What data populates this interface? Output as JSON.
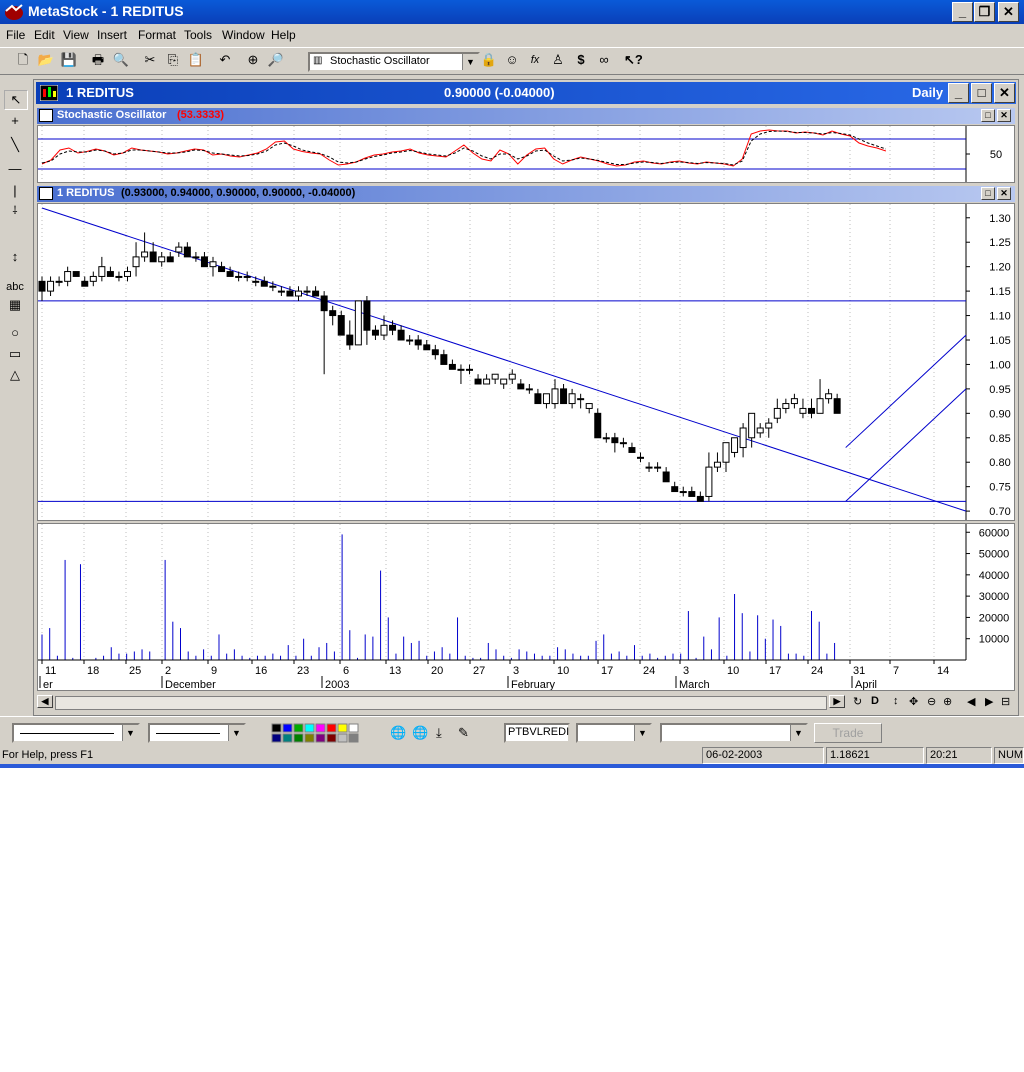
{
  "window": {
    "app_title": "MetaStock - 1 REDITUS"
  },
  "menu": [
    "File",
    "Edit",
    "View",
    "Insert",
    "Format",
    "Tools",
    "Window",
    "Help"
  ],
  "toolbar": {
    "indicator_select": "Stochastic Oscillator"
  },
  "chart_window": {
    "title": "1 REDITUS",
    "price_readout": "0.90000 (-0.04000)",
    "period": "Daily"
  },
  "stoch_pane": {
    "label": "Stochastic Oscillator",
    "value": "(53.3333)",
    "level_label": "50"
  },
  "price_pane": {
    "label": "1 REDITUS",
    "ohlc": "(0.93000, 0.94000, 0.90000, 0.90000, -0.04000)"
  },
  "colors": {
    "accent_red": "#ff0000",
    "line_blue": "#0000cc",
    "title_blue": "#0a3fb8"
  },
  "chart_data": [
    {
      "type": "line",
      "title": "Stochastic Oscillator",
      "series": [
        {
          "name": "Stochastic Oscillator",
          "color": "#ff0000",
          "values": [
            30,
            38,
            58,
            62,
            52,
            55,
            60,
            56,
            48,
            52,
            62,
            58,
            56,
            54,
            50,
            52,
            56,
            60,
            58,
            48,
            50,
            46,
            44,
            48,
            52,
            60,
            74,
            76,
            60,
            55,
            52,
            50,
            38,
            28,
            30,
            34,
            42,
            48,
            50,
            54,
            56,
            60,
            52,
            48,
            46,
            44,
            56,
            68,
            52,
            40,
            36,
            58,
            50,
            30,
            48,
            60,
            62,
            40,
            30,
            38,
            44,
            40,
            36,
            30,
            26,
            28,
            34,
            36,
            32,
            30,
            34,
            36,
            32,
            30,
            34,
            32,
            30,
            26,
            40,
            90,
            96,
            98,
            96,
            96,
            92,
            94,
            92,
            88,
            96,
            90,
            86,
            72,
            66,
            62,
            56
          ]
        },
        {
          "name": "",
          "style": "dashed",
          "color": "#000000",
          "values": [
            32,
            36,
            50,
            56,
            54,
            54,
            58,
            56,
            50,
            52,
            58,
            58,
            56,
            54,
            52,
            52,
            54,
            58,
            57,
            52,
            50,
            48,
            46,
            47,
            50,
            56,
            68,
            72,
            66,
            58,
            54,
            51,
            44,
            34,
            32,
            34,
            40,
            45,
            48,
            52,
            54,
            57,
            54,
            50,
            48,
            46,
            52,
            62,
            56,
            46,
            40,
            50,
            50,
            40,
            46,
            56,
            58,
            46,
            36,
            38,
            42,
            40,
            37,
            33,
            29,
            29,
            32,
            34,
            33,
            31,
            33,
            34,
            33,
            31,
            33,
            32,
            31,
            28,
            36,
            76,
            90,
            95,
            96,
            95,
            93,
            93,
            92,
            90,
            93,
            91,
            88,
            80,
            72,
            66,
            60
          ]
        }
      ],
      "level_lines": [
        80,
        20
      ],
      "ytick_labels": [
        "50"
      ]
    },
    {
      "type": "candlestick",
      "title": "1 REDITUS",
      "ylim": [
        0.69,
        1.32
      ],
      "yticks": [
        1.3,
        1.25,
        1.2,
        1.15,
        1.1,
        1.05,
        1.0,
        0.95,
        0.9,
        0.85,
        0.8,
        0.75,
        0.7
      ],
      "hlines": [
        1.13,
        0.72
      ],
      "trendlines": [
        {
          "from": [
            0,
            1.32
          ],
          "to": [
            120,
            0.7
          ]
        },
        {
          "from": [
            94,
            0.83
          ],
          "to": [
            112,
            1.06
          ]
        },
        {
          "from": [
            94,
            0.72
          ],
          "to": [
            112,
            0.95
          ]
        }
      ],
      "candles": [
        [
          1.17,
          1.18,
          1.13,
          1.15
        ],
        [
          1.15,
          1.18,
          1.14,
          1.17
        ],
        [
          1.17,
          1.18,
          1.16,
          1.17
        ],
        [
          1.17,
          1.2,
          1.16,
          1.19
        ],
        [
          1.19,
          1.19,
          1.18,
          1.18
        ],
        [
          1.17,
          1.18,
          1.16,
          1.16
        ],
        [
          1.17,
          1.19,
          1.16,
          1.18
        ],
        [
          1.18,
          1.22,
          1.17,
          1.2
        ],
        [
          1.19,
          1.2,
          1.18,
          1.18
        ],
        [
          1.18,
          1.19,
          1.17,
          1.18
        ],
        [
          1.18,
          1.2,
          1.17,
          1.19
        ],
        [
          1.2,
          1.25,
          1.18,
          1.22
        ],
        [
          1.22,
          1.27,
          1.21,
          1.23
        ],
        [
          1.23,
          1.25,
          1.21,
          1.21
        ],
        [
          1.21,
          1.23,
          1.2,
          1.22
        ],
        [
          1.22,
          1.23,
          1.21,
          1.21
        ],
        [
          1.23,
          1.25,
          1.22,
          1.24
        ],
        [
          1.24,
          1.25,
          1.22,
          1.22
        ],
        [
          1.22,
          1.23,
          1.21,
          1.22
        ],
        [
          1.22,
          1.23,
          1.2,
          1.2
        ],
        [
          1.2,
          1.22,
          1.18,
          1.21
        ],
        [
          1.2,
          1.21,
          1.19,
          1.19
        ],
        [
          1.19,
          1.2,
          1.18,
          1.18
        ],
        [
          1.18,
          1.19,
          1.17,
          1.18
        ],
        [
          1.18,
          1.19,
          1.17,
          1.18
        ],
        [
          1.17,
          1.18,
          1.16,
          1.17
        ],
        [
          1.17,
          1.18,
          1.16,
          1.16
        ],
        [
          1.16,
          1.17,
          1.15,
          1.16
        ],
        [
          1.15,
          1.16,
          1.14,
          1.15
        ],
        [
          1.15,
          1.16,
          1.14,
          1.14
        ],
        [
          1.14,
          1.16,
          1.13,
          1.15
        ],
        [
          1.15,
          1.16,
          1.14,
          1.15
        ],
        [
          1.15,
          1.16,
          1.14,
          1.14
        ],
        [
          1.14,
          1.15,
          0.98,
          1.11
        ],
        [
          1.11,
          1.12,
          1.08,
          1.1
        ],
        [
          1.1,
          1.11,
          1.07,
          1.06
        ],
        [
          1.06,
          1.09,
          1.03,
          1.04
        ],
        [
          1.04,
          1.13,
          1.04,
          1.13
        ],
        [
          1.13,
          1.14,
          1.04,
          1.07
        ],
        [
          1.07,
          1.08,
          1.05,
          1.06
        ],
        [
          1.06,
          1.1,
          1.05,
          1.08
        ],
        [
          1.08,
          1.09,
          1.06,
          1.07
        ],
        [
          1.07,
          1.08,
          1.05,
          1.05
        ],
        [
          1.05,
          1.06,
          1.04,
          1.05
        ],
        [
          1.05,
          1.06,
          1.03,
          1.04
        ],
        [
          1.04,
          1.05,
          1.03,
          1.03
        ],
        [
          1.03,
          1.04,
          1.01,
          1.02
        ],
        [
          1.02,
          1.03,
          1.0,
          1.0
        ],
        [
          1.0,
          1.01,
          0.99,
          0.99
        ],
        [
          0.99,
          1.0,
          0.96,
          0.99
        ],
        [
          0.99,
          1.0,
          0.98,
          0.99
        ],
        [
          0.97,
          0.98,
          0.96,
          0.96
        ],
        [
          0.96,
          0.98,
          0.96,
          0.97
        ],
        [
          0.97,
          0.98,
          0.96,
          0.98
        ],
        [
          0.96,
          0.97,
          0.95,
          0.97
        ],
        [
          0.97,
          0.99,
          0.96,
          0.98
        ],
        [
          0.96,
          0.97,
          0.95,
          0.95
        ],
        [
          0.95,
          0.96,
          0.94,
          0.95
        ],
        [
          0.94,
          0.95,
          0.92,
          0.92
        ],
        [
          0.92,
          0.93,
          0.91,
          0.94
        ],
        [
          0.92,
          0.97,
          0.91,
          0.95
        ],
        [
          0.95,
          0.96,
          0.92,
          0.92
        ],
        [
          0.92,
          0.95,
          0.91,
          0.94
        ],
        [
          0.93,
          0.94,
          0.91,
          0.93
        ],
        [
          0.91,
          0.92,
          0.9,
          0.92
        ],
        [
          0.9,
          0.91,
          0.85,
          0.85
        ],
        [
          0.85,
          0.86,
          0.84,
          0.85
        ],
        [
          0.85,
          0.86,
          0.82,
          0.84
        ],
        [
          0.84,
          0.85,
          0.83,
          0.84
        ],
        [
          0.83,
          0.84,
          0.82,
          0.82
        ],
        [
          0.81,
          0.82,
          0.8,
          0.81
        ],
        [
          0.79,
          0.8,
          0.78,
          0.79
        ],
        [
          0.79,
          0.8,
          0.78,
          0.79
        ],
        [
          0.78,
          0.79,
          0.76,
          0.76
        ],
        [
          0.75,
          0.76,
          0.74,
          0.74
        ],
        [
          0.74,
          0.75,
          0.73,
          0.74
        ],
        [
          0.74,
          0.75,
          0.73,
          0.73
        ],
        [
          0.73,
          0.74,
          0.72,
          0.72
        ],
        [
          0.73,
          0.82,
          0.72,
          0.79
        ],
        [
          0.79,
          0.82,
          0.78,
          0.8
        ],
        [
          0.8,
          0.83,
          0.78,
          0.84
        ],
        [
          0.82,
          0.85,
          0.81,
          0.85
        ],
        [
          0.83,
          0.88,
          0.81,
          0.87
        ],
        [
          0.85,
          0.9,
          0.83,
          0.9
        ],
        [
          0.86,
          0.88,
          0.85,
          0.87
        ],
        [
          0.87,
          0.89,
          0.85,
          0.88
        ],
        [
          0.89,
          0.93,
          0.88,
          0.91
        ],
        [
          0.91,
          0.93,
          0.9,
          0.92
        ],
        [
          0.92,
          0.94,
          0.91,
          0.93
        ],
        [
          0.9,
          0.93,
          0.89,
          0.91
        ],
        [
          0.91,
          0.93,
          0.89,
          0.9
        ],
        [
          0.9,
          0.97,
          0.9,
          0.93
        ],
        [
          0.93,
          0.95,
          0.92,
          0.94
        ],
        [
          0.93,
          0.94,
          0.9,
          0.9
        ]
      ]
    },
    {
      "type": "bar",
      "title": "Volume",
      "ylim": [
        0,
        62000
      ],
      "yticks": [
        60000,
        50000,
        40000,
        30000,
        20000,
        10000
      ],
      "values": [
        12000,
        15000,
        2000,
        47000,
        1000,
        45000,
        0,
        1000,
        2000,
        6000,
        3000,
        3000,
        4000,
        5000,
        4000,
        0,
        47000,
        18000,
        15000,
        4000,
        2000,
        5000,
        2000,
        12000,
        3000,
        5000,
        2000,
        1000,
        2000,
        2000,
        3000,
        2000,
        7000,
        2000,
        10000,
        2000,
        6000,
        8000,
        4000,
        59000,
        14000,
        1000,
        12000,
        11000,
        42000,
        20000,
        3000,
        11000,
        8000,
        9000,
        2000,
        4000,
        6000,
        3000,
        20000,
        2000,
        1000,
        1000,
        8000,
        5000,
        2000,
        1000,
        5000,
        4000,
        3000,
        2000,
        2000,
        6000,
        5000,
        3000,
        2000,
        2000,
        9000,
        12000,
        3000,
        4000,
        2000,
        7000,
        2000,
        3000,
        1000,
        2000,
        3000,
        3000,
        23000,
        1000,
        11000,
        5000,
        20000,
        2000,
        31000,
        22000,
        4000,
        21000,
        10000,
        19000,
        16000,
        3000,
        3000,
        2000,
        23000,
        18000,
        3000,
        8000
      ]
    }
  ],
  "x_axis": {
    "day_labels": [
      "11",
      "18",
      "25",
      "2",
      "9",
      "16",
      "23",
      "6",
      "13",
      "20",
      "27",
      "3",
      "10",
      "17",
      "24",
      "3",
      "10",
      "17",
      "24",
      "31",
      "7",
      "14"
    ],
    "month_labels": [
      "er",
      "December",
      "2003",
      "February",
      "March",
      "April"
    ]
  },
  "bottom": {
    "symbol_field": "PTBVLREDI",
    "trade_button": "Trade"
  },
  "status": {
    "help": "For Help, press F1",
    "date": "06-02-2003",
    "value": "1.18621",
    "time": "20:21",
    "mode": "NUM"
  }
}
